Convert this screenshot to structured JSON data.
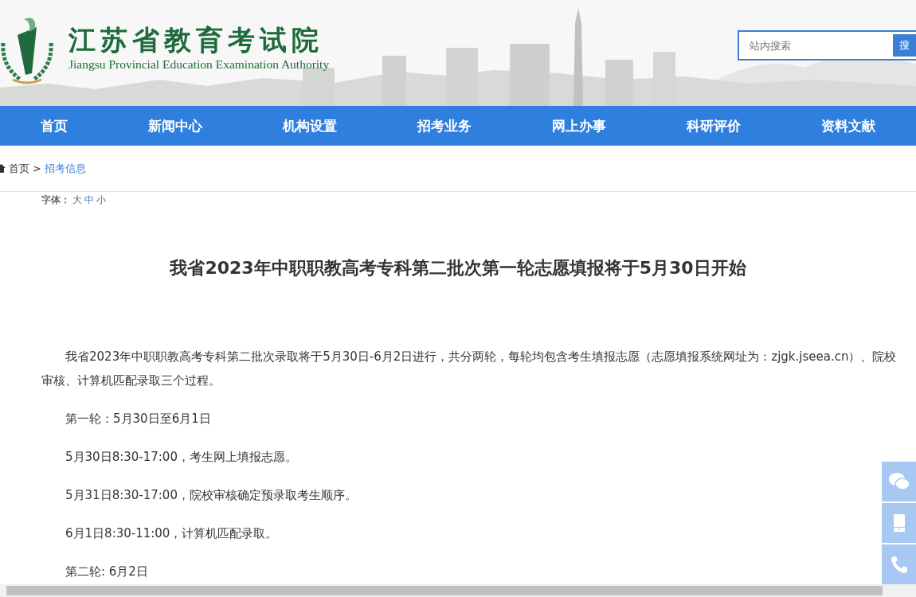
{
  "header": {
    "title": "江苏省教育考试院",
    "subtitle": "Jiangsu Provincial Education Examination Authority",
    "search": {
      "placeholder": "站内搜索",
      "button": "搜"
    }
  },
  "nav": [
    {
      "label": "首页"
    },
    {
      "label": "新闻中心"
    },
    {
      "label": "机构设置"
    },
    {
      "label": "招考业务"
    },
    {
      "label": "网上办事"
    },
    {
      "label": "科研评价"
    },
    {
      "label": "资料文献"
    }
  ],
  "breadcrumb": [
    {
      "label": "首页"
    },
    {
      "label": "招考信息"
    }
  ],
  "breadcrumb_separator": ">",
  "font_size": {
    "label": "字体：",
    "options": [
      {
        "label": "大",
        "selected": false
      },
      {
        "label": "中",
        "selected": true
      },
      {
        "label": "小",
        "selected": false
      }
    ]
  },
  "article": {
    "title": "我省2023年中职职教高考专科第二批次第一轮志愿填报将于5月30日开始",
    "paragraphs": [
      "我省2023年中职职教高考专科第二批次录取将于5月30日-6月2日进行，共分两轮，每轮均包含考生填报志愿（志愿填报系统网址为：zjgk.jseea.cn）、院校审核、计算机匹配录取三个过程。",
      "第一轮：5月30日至6月1日",
      "5月30日8:30-17:00，考生网上填报志愿。",
      "5月31日8:30-17:00，院校审核确定预录取考生顺序。",
      "6月1日8:30-11:00，计算机匹配录取。",
      "第二轮: 6月2日"
    ]
  },
  "side_buttons": [
    {
      "kind": "chat"
    },
    {
      "kind": "phone"
    },
    {
      "kind": "call"
    }
  ]
}
